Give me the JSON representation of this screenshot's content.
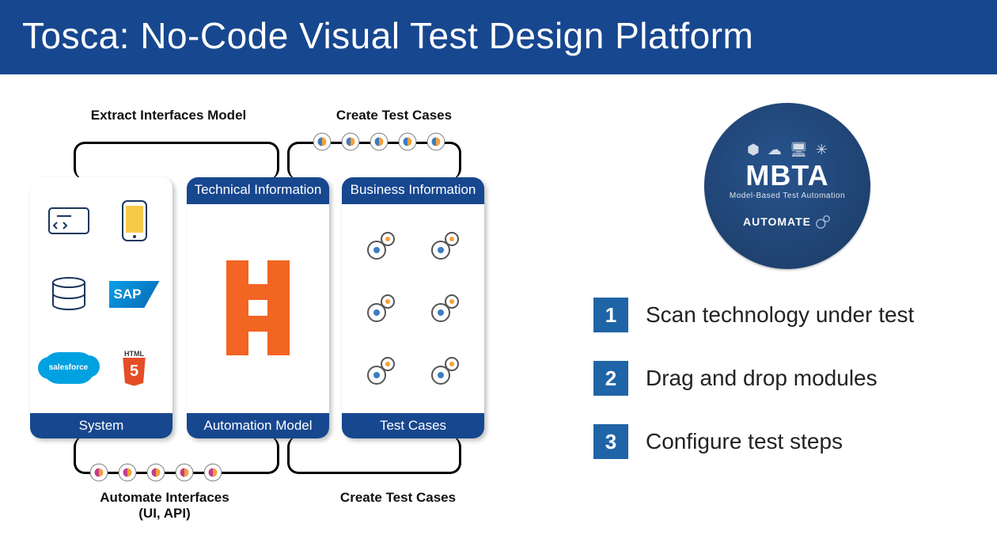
{
  "title": "Tosca: No-Code Visual Test Design Platform",
  "labels": {
    "extract": "Extract Interfaces Model",
    "create_top": "Create Test Cases",
    "automate": "Automate Interfaces\n(UI, API)",
    "create_bottom": "Create Test Cases"
  },
  "cards": {
    "system": {
      "footer": "System",
      "icons": [
        "code-window",
        "smartphone",
        "database",
        "sap",
        "salesforce",
        "html5"
      ]
    },
    "model": {
      "header": "Technical Information",
      "footer": "Automation Model"
    },
    "tests": {
      "header": "Business Information",
      "footer": "Test Cases"
    }
  },
  "badge": {
    "title": "MBTA",
    "subtitle": "Model-Based Test Automation",
    "tag": "AUTOMATE"
  },
  "steps": [
    {
      "num": "1",
      "text": "Scan technology under test"
    },
    {
      "num": "2",
      "text": "Drag and drop modules"
    },
    {
      "num": "3",
      "text": "Configure test steps"
    }
  ],
  "brands": {
    "sap": "SAP",
    "salesforce": "salesforce",
    "html5_top": "HTML",
    "html5_glyph": "5"
  }
}
